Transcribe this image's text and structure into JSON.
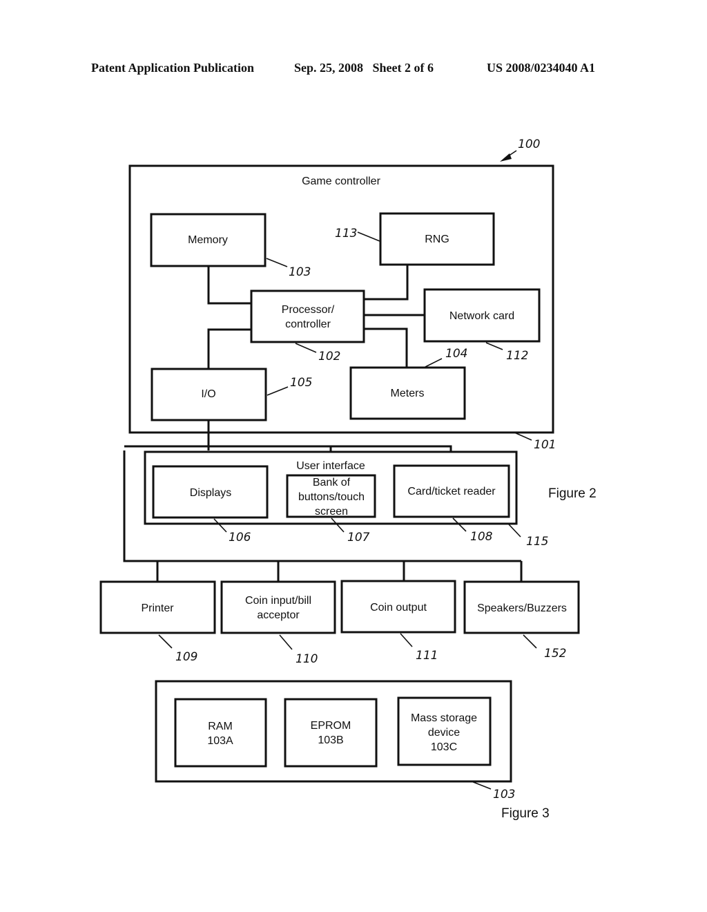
{
  "header": {
    "publication": "Patent Application Publication",
    "date_sheet": "Sep. 25, 2008   Sheet 2 of 6",
    "number": "US 2008/0234040 A1"
  },
  "figure2": {
    "caption": "Figure 2",
    "system_ref": "100",
    "game_controller": {
      "label": "Game controller",
      "ref": "101"
    },
    "memory": {
      "label": "Memory",
      "ref": "103"
    },
    "rng": {
      "label": "RNG",
      "ref": "113"
    },
    "processor": {
      "line1": "Processor/",
      "line2": "controller",
      "ref": "102"
    },
    "network_card": {
      "label": "Network card",
      "ref": "112"
    },
    "io": {
      "label": "I/O",
      "ref": "105"
    },
    "meters": {
      "label": "Meters",
      "ref": "104"
    },
    "user_interface": {
      "label": "User interface",
      "ref": "115"
    },
    "displays": {
      "label": "Displays",
      "ref": "106"
    },
    "buttons": {
      "line1": "Bank of",
      "line2": "buttons/touch",
      "line3": "screen",
      "ref": "107"
    },
    "card_reader": {
      "label": "Card/ticket reader",
      "ref": "108"
    },
    "printer": {
      "label": "Printer",
      "ref": "109"
    },
    "coin_input": {
      "line1": "Coin input/bill",
      "line2": "acceptor",
      "ref": "110"
    },
    "coin_output": {
      "label": "Coin output",
      "ref": "111"
    },
    "speakers": {
      "label": "Speakers/Buzzers",
      "ref": "152"
    }
  },
  "figure3": {
    "caption": "Figure 3",
    "memory_ref": "103",
    "ram": {
      "line1": "RAM",
      "line2": "103A"
    },
    "eprom": {
      "line1": "EPROM",
      "line2": "103B"
    },
    "mass_storage": {
      "line1": "Mass storage",
      "line2": "device",
      "line3": "103C"
    }
  }
}
